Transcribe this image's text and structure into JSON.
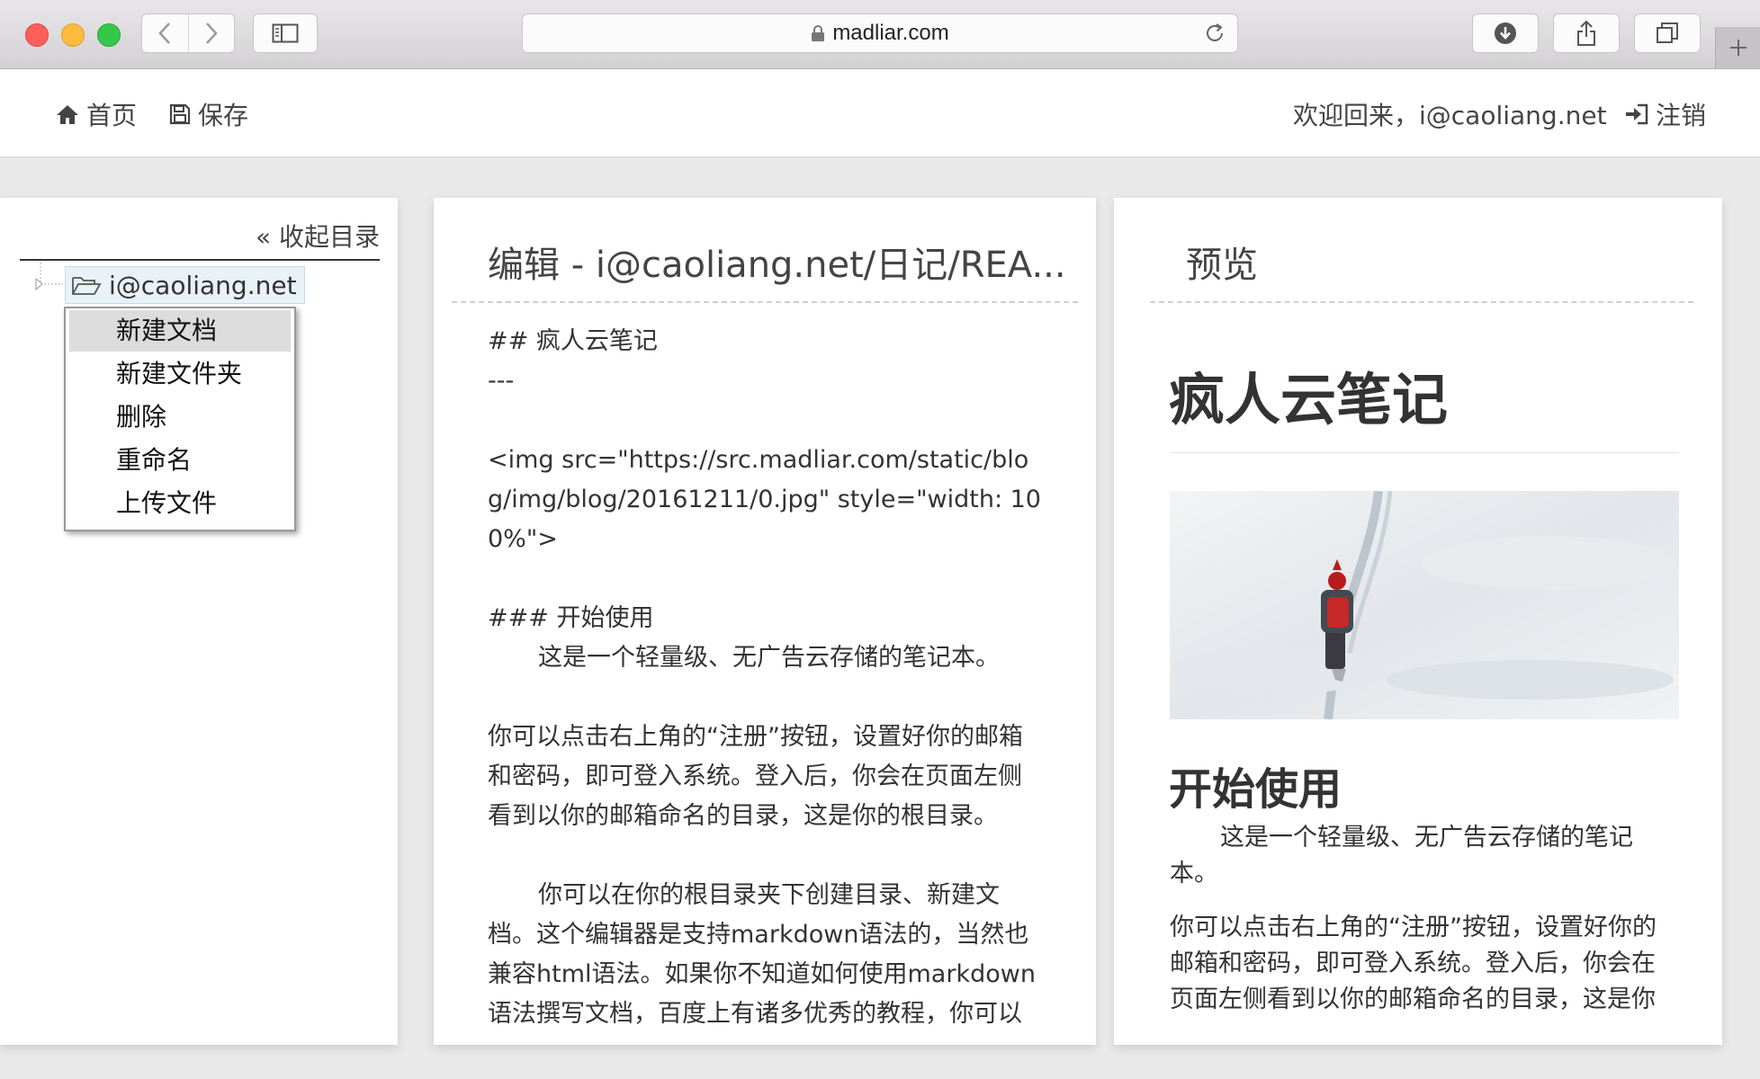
{
  "browser": {
    "url": "madliar.com"
  },
  "navbar": {
    "home": "首页",
    "save": "保存",
    "welcome": "欢迎回来，i@caoliang.net",
    "logout": "注销"
  },
  "sidebar": {
    "collapse": "« 收起目录",
    "root_folder": "i@caoliang.net",
    "context_menu": [
      "新建文档",
      "新建文件夹",
      "删除",
      "重命名",
      "上传文件"
    ]
  },
  "editor": {
    "title": "编辑 - i@caoliang.net/日记/REA...",
    "lines": [
      "## 疯人云笔记",
      "---",
      "",
      "<img src=\"https://src.madliar.com/static/blog/img/blog/20161211/0.jpg\" style=\"width: 100%\">",
      "",
      "### 开始使用",
      "这是一个轻量级、无广告云存储的笔记本。",
      "",
      "你可以点击右上角的“注册”按钮，设置好你的邮箱和密码，即可登入系统。登入后，你会在页面左侧看到以你的邮箱命名的目录，这是你的根目录。",
      "",
      "你可以在你的根目录夹下创建目录、新建文档。这个编辑器是支持markdown语法的，当然也兼容html语法。如果你不知道如何使用markdown语法撰写文档，百度上有诸多优秀的教程，你可以"
    ]
  },
  "preview": {
    "title": "预览",
    "h2": "疯人云笔记",
    "h3": "开始使用",
    "p1": "这是一个轻量级、无广告云存储的笔记本。",
    "p2": "你可以点击右上角的“注册”按钮，设置好你的邮箱和密码，即可登入系统。登入后，你会在页面左侧看到以你的邮箱命名的目录，这是你"
  }
}
